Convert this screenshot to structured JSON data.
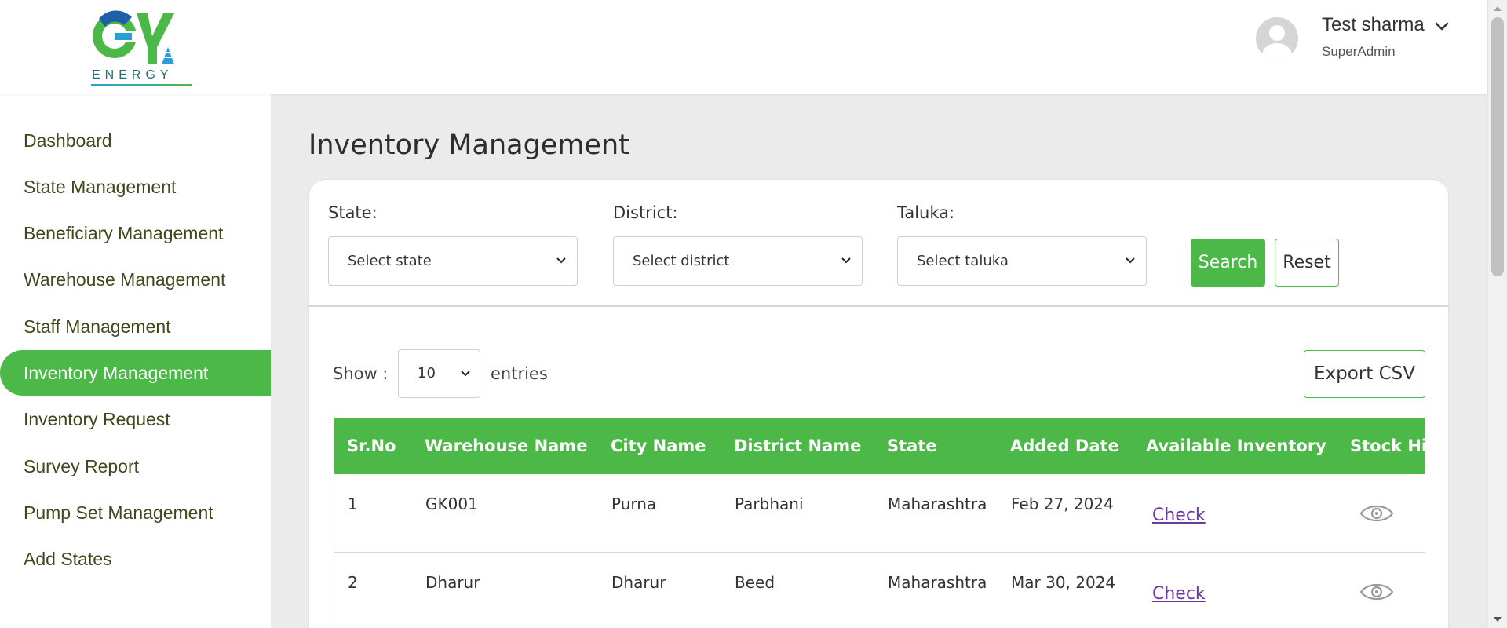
{
  "header": {
    "logo_text": "ENERGY",
    "user_name": "Test sharma",
    "user_role": "SuperAdmin"
  },
  "sidebar": {
    "items": [
      {
        "label": "Dashboard"
      },
      {
        "label": "State Management"
      },
      {
        "label": "Beneficiary Management"
      },
      {
        "label": "Warehouse Management"
      },
      {
        "label": "Staff Management"
      },
      {
        "label": "Inventory Management",
        "active": true
      },
      {
        "label": "Inventory Request"
      },
      {
        "label": "Survey Report"
      },
      {
        "label": "Pump Set Management"
      },
      {
        "label": "Add States"
      }
    ]
  },
  "main": {
    "title": "Inventory Management",
    "filters": {
      "state_label": "State:",
      "state_value": "Select state",
      "district_label": "District:",
      "district_value": "Select district",
      "taluka_label": "Taluka:",
      "taluka_value": "Select taluka",
      "search_label": "Search",
      "reset_label": "Reset"
    },
    "show_label": "Show :",
    "show_value": "10",
    "entries_label": "entries",
    "export_label": "Export CSV"
  },
  "table": {
    "columns": [
      "Sr.No",
      "Warehouse Name",
      "City Name",
      "District Name",
      "State",
      "Added Date",
      "Available Inventory",
      "Stock Hi"
    ],
    "rows": [
      {
        "sr": "1",
        "warehouse": "GK001",
        "city": "Purna",
        "district": "Parbhani",
        "state": "Maharashtra",
        "date": "Feb 27, 2024",
        "inventory": "Check"
      },
      {
        "sr": "2",
        "warehouse": "Dharur",
        "city": "Dharur",
        "district": "Beed",
        "state": "Maharashtra",
        "date": "Mar 30, 2024",
        "inventory": "Check"
      }
    ]
  },
  "colors": {
    "accent": "#4cb848",
    "link": "#6a3aa0"
  }
}
